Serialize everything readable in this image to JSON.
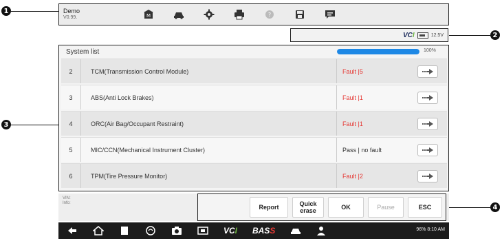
{
  "callouts": [
    "1",
    "2",
    "3",
    "4"
  ],
  "app": {
    "name": "Demo",
    "version": "V0.99."
  },
  "toolbar": {
    "icons": [
      "home-icon",
      "vehicle-menu-icon",
      "settings-icon",
      "print-icon",
      "help-icon",
      "save-icon",
      "data-logging-icon"
    ]
  },
  "status": {
    "vci_prefix": "VC",
    "vci_suffix": "I",
    "voltage": "12.5V"
  },
  "system_list": {
    "title": "System list",
    "progress_percent": 100,
    "progress_label": "100%",
    "rows": [
      {
        "num": "2",
        "name": "TCM(Transmission Control Module)",
        "status": "Fault |5",
        "state": "fault"
      },
      {
        "num": "3",
        "name": "ABS(Anti Lock Brakes)",
        "status": "Fault |1",
        "state": "fault"
      },
      {
        "num": "4",
        "name": "ORC(Air Bag/Occupant Restraint)",
        "status": "Fault |1",
        "state": "fault"
      },
      {
        "num": "5",
        "name": "MIC/CCN(Mechanical Instrument Cluster)",
        "status": "Pass | no fault",
        "state": "pass"
      },
      {
        "num": "6",
        "name": "TPM(Tire Pressure Monitor)",
        "status": "Fault |2",
        "state": "fault"
      }
    ]
  },
  "bottom": {
    "vin_label": "VIN:",
    "info_label": "Info:",
    "buttons": {
      "report": "Report",
      "quick_erase": "Quick erase",
      "ok": "OK",
      "pause": "Pause",
      "esc": "ESC"
    }
  },
  "android": {
    "vci_prefix": "VC",
    "vci_suffix": "I",
    "bas_prefix": "BAS",
    "bas_suffix": "S",
    "status_text": "96% 8:10 AM"
  },
  "colors": {
    "fault": "#e53935",
    "progress": "#1e88e5",
    "vci_green": "#6cb33f"
  }
}
